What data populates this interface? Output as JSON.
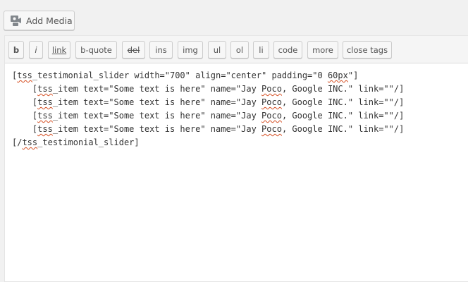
{
  "media": {
    "add_media_label": "Add Media",
    "icon": "media-icon"
  },
  "toolbar": {
    "buttons": [
      "b",
      "i",
      "link",
      "b-quote",
      "del",
      "ins",
      "img",
      "ul",
      "ol",
      "li",
      "code",
      "more",
      "close tags"
    ]
  },
  "editor": {
    "lines": [
      {
        "parts": [
          "[",
          "tss",
          "_testimonial_slider width=\"700\" align=\"center\" padding=\"0 ",
          "60px",
          "\"]"
        ]
      },
      {
        "parts": [
          "    [",
          "tss",
          "_item text=\"Some text is here\" name=\"Jay ",
          "Poco",
          ", Google INC.\" link=\"\"/]"
        ]
      },
      {
        "parts": [
          "    [",
          "tss",
          "_item text=\"Some text is here\" name=\"Jay ",
          "Poco",
          ", Google INC.\" link=\"\"/]"
        ]
      },
      {
        "parts": [
          "    [",
          "tss",
          "_item text=\"Some text is here\" name=\"Jay ",
          "Poco",
          ", Google INC.\" link=\"\"/]"
        ]
      },
      {
        "parts": [
          "    [",
          "tss",
          "_item text=\"Some text is here\" name=\"Jay ",
          "Poco",
          ", Google INC.\" link=\"\"/]"
        ]
      },
      {
        "parts": [
          "[/",
          "tss",
          "_testimonial_slider]",
          "",
          ""
        ]
      }
    ]
  }
}
